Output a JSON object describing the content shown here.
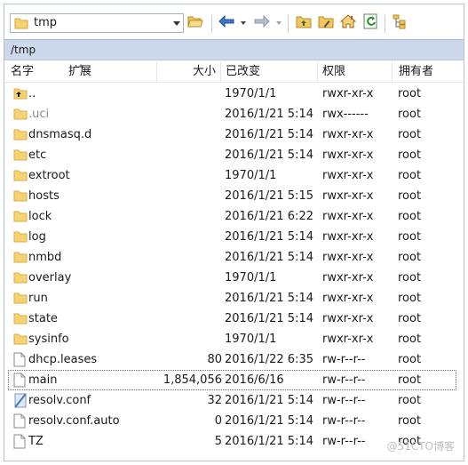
{
  "toolbar": {
    "path_combo_value": "tmp",
    "icons": [
      "folder-icon",
      "open-folder-icon",
      "back-arrow-icon",
      "forward-arrow-icon",
      "parent-folder-icon",
      "new-folder-icon",
      "home-icon",
      "refresh-icon",
      "tree-view-icon"
    ]
  },
  "path_bar": {
    "path": "/tmp"
  },
  "columns": {
    "name": "名字",
    "ext": "扩展",
    "size": "大小",
    "modified": "已改变",
    "permissions": "权限",
    "owner": "拥有者"
  },
  "files": [
    {
      "icon": "parent-dir-icon",
      "name": "..",
      "size": "",
      "modified": "1970/1/1",
      "permissions": "rwxr-xr-x",
      "owner": "root"
    },
    {
      "icon": "folder-icon",
      "name": ".uci",
      "size": "",
      "modified": "2016/1/21 5:14",
      "permissions": "rwx------",
      "owner": "root",
      "dim": true
    },
    {
      "icon": "folder-icon",
      "name": "dnsmasq.d",
      "size": "",
      "modified": "2016/1/21 5:14",
      "permissions": "rwxr-xr-x",
      "owner": "root"
    },
    {
      "icon": "folder-icon",
      "name": "etc",
      "size": "",
      "modified": "2016/1/21 5:14",
      "permissions": "rwxr-xr-x",
      "owner": "root"
    },
    {
      "icon": "folder-icon",
      "name": "extroot",
      "size": "",
      "modified": "1970/1/1",
      "permissions": "rwxr-xr-x",
      "owner": "root"
    },
    {
      "icon": "folder-icon",
      "name": "hosts",
      "size": "",
      "modified": "2016/1/21 5:15",
      "permissions": "rwxr-xr-x",
      "owner": "root"
    },
    {
      "icon": "folder-icon",
      "name": "lock",
      "size": "",
      "modified": "2016/1/21 6:22",
      "permissions": "rwxr-xr-x",
      "owner": "root"
    },
    {
      "icon": "folder-icon",
      "name": "log",
      "size": "",
      "modified": "2016/1/21 5:14",
      "permissions": "rwxr-xr-x",
      "owner": "root"
    },
    {
      "icon": "folder-icon",
      "name": "nmbd",
      "size": "",
      "modified": "2016/1/21 5:14",
      "permissions": "rwxr-xr-x",
      "owner": "root"
    },
    {
      "icon": "folder-icon",
      "name": "overlay",
      "size": "",
      "modified": "1970/1/1",
      "permissions": "rwxr-xr-x",
      "owner": "root"
    },
    {
      "icon": "folder-icon",
      "name": "run",
      "size": "",
      "modified": "2016/1/21 5:14",
      "permissions": "rwxr-xr-x",
      "owner": "root"
    },
    {
      "icon": "folder-icon",
      "name": "state",
      "size": "",
      "modified": "2016/1/21 5:14",
      "permissions": "rwxr-xr-x",
      "owner": "root"
    },
    {
      "icon": "folder-icon",
      "name": "sysinfo",
      "size": "",
      "modified": "1970/1/1",
      "permissions": "rwxr-xr-x",
      "owner": "root"
    },
    {
      "icon": "file-icon",
      "name": "dhcp.leases",
      "size": "80",
      "modified": "2016/1/22 6:35",
      "permissions": "rw-r--r--",
      "owner": "root"
    },
    {
      "icon": "file-icon",
      "name": "main",
      "size": "1,854,056",
      "modified": "2016/6/16",
      "permissions": "rw-r--r--",
      "owner": "root",
      "selected": true
    },
    {
      "icon": "file-link-icon",
      "name": "resolv.conf",
      "size": "32",
      "modified": "2016/1/21 5:14",
      "permissions": "rw-r--r--",
      "owner": "root"
    },
    {
      "icon": "file-icon",
      "name": "resolv.conf.auto",
      "size": "0",
      "modified": "2016/1/21 5:14",
      "permissions": "rw-r--r--",
      "owner": "root"
    },
    {
      "icon": "file-icon",
      "name": "TZ",
      "size": "5",
      "modified": "2016/1/21 5:14",
      "permissions": "rw-r--r--",
      "owner": "root"
    }
  ],
  "watermark": "@51CTO博客",
  "colors": {
    "folder": "#f6d372",
    "path_bar": "#ccd9ea",
    "selection_border": "#6d6d6d"
  }
}
